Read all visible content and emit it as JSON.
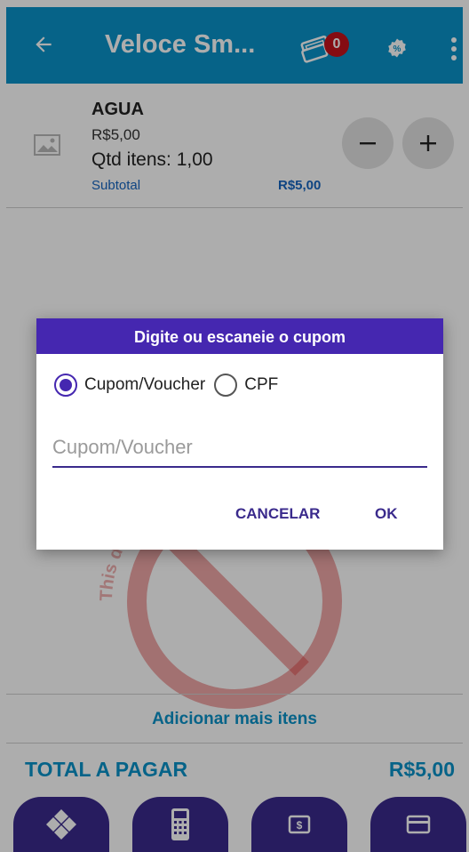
{
  "appbar": {
    "title": "Veloce Sm...",
    "cart_badge": "0"
  },
  "product": {
    "name": "AGUA",
    "price": "R$5,00",
    "quantity": "Qtd itens: 1,00",
    "subtotal_label": "Subtotal",
    "subtotal_value": "R$5,00"
  },
  "footer": {
    "add_more": "Adicionar mais itens",
    "total_label": "TOTAL A PAGAR",
    "total_value": "R$5,00"
  },
  "watermark": {
    "text": "This device at risk. Don't deal ! "
  },
  "dialog": {
    "title": "Digite ou escaneie o cupom",
    "option_coupon": "Cupom/Voucher",
    "option_cpf": "CPF",
    "selected": "Cupom/Voucher",
    "input_placeholder": "Cupom/Voucher",
    "input_value": "",
    "cancel_label": "CANCELAR",
    "ok_label": "OK"
  },
  "colors": {
    "appbar": "#0a93c9",
    "accent": "#4527b0",
    "pay_buttons": "#3a2a8c",
    "badge": "#c4131b"
  }
}
